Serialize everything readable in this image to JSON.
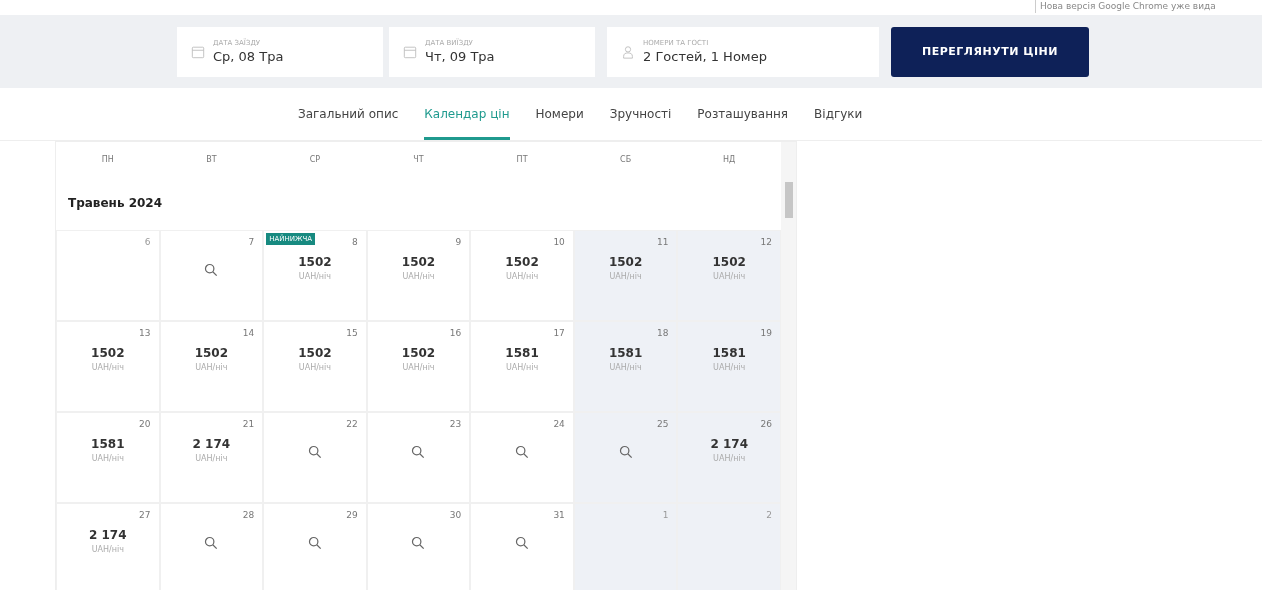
{
  "notice": "Нова версія Google Chrome уже вида",
  "search": {
    "fields": [
      {
        "kind": "date",
        "label": "ДАТА ЗАЇЗДУ",
        "value": "Ср, 08 Тра"
      },
      {
        "kind": "date",
        "label": "ДАТА ВИЇЗДУ",
        "value": "Чт, 09 Тра"
      },
      {
        "kind": "guests",
        "label": "НОМЕРИ ТА ГОСТІ",
        "value": "2 Гостей, 1 Номер"
      }
    ],
    "button": "ПЕРЕГЛЯНУТИ ЦІНИ"
  },
  "tabs": [
    {
      "label": "Загальний опис",
      "selected": false
    },
    {
      "label": "Календар цін",
      "selected": true
    },
    {
      "label": "Номери",
      "selected": false
    },
    {
      "label": "Зручності",
      "selected": false
    },
    {
      "label": "Розташування",
      "selected": false
    },
    {
      "label": "Відгуки",
      "selected": false
    }
  ],
  "calendar": {
    "weekdays": [
      {
        "label": "ПН",
        "weekend": false
      },
      {
        "label": "ВТ",
        "weekend": false
      },
      {
        "label": "СР",
        "weekend": false
      },
      {
        "label": "ЧТ",
        "weekend": false
      },
      {
        "label": "ПТ",
        "weekend": false
      },
      {
        "label": "СБ",
        "weekend": true
      },
      {
        "label": "НД",
        "weekend": true
      }
    ],
    "month": "Травень 2024",
    "weeks": [
      [
        {
          "day": "6",
          "kind": "past"
        },
        {
          "day": "7",
          "kind": "search"
        },
        {
          "day": "8",
          "kind": "price",
          "price": "1502",
          "unit": "UAH/ніч",
          "badge": "НАЙНИЖЧА"
        },
        {
          "day": "9",
          "kind": "price",
          "price": "1502",
          "unit": "UAH/ніч"
        },
        {
          "day": "10",
          "kind": "price",
          "price": "1502",
          "unit": "UAH/ніч"
        },
        {
          "day": "11",
          "kind": "price",
          "price": "1502",
          "unit": "UAH/ніч"
        },
        {
          "day": "12",
          "kind": "price",
          "price": "1502",
          "unit": "UAH/ніч"
        }
      ],
      [
        {
          "day": "13",
          "kind": "price",
          "price": "1502",
          "unit": "UAH/ніч"
        },
        {
          "day": "14",
          "kind": "price",
          "price": "1502",
          "unit": "UAH/ніч"
        },
        {
          "day": "15",
          "kind": "price",
          "price": "1502",
          "unit": "UAH/ніч"
        },
        {
          "day": "16",
          "kind": "price",
          "price": "1502",
          "unit": "UAH/ніч"
        },
        {
          "day": "17",
          "kind": "price",
          "price": "1581",
          "unit": "UAH/ніч"
        },
        {
          "day": "18",
          "kind": "price",
          "price": "1581",
          "unit": "UAH/ніч"
        },
        {
          "day": "19",
          "kind": "price",
          "price": "1581",
          "unit": "UAH/ніч"
        }
      ],
      [
        {
          "day": "20",
          "kind": "price",
          "price": "1581",
          "unit": "UAH/ніч"
        },
        {
          "day": "21",
          "kind": "price",
          "price": "2 174",
          "unit": "UAH/ніч"
        },
        {
          "day": "22",
          "kind": "search"
        },
        {
          "day": "23",
          "kind": "search"
        },
        {
          "day": "24",
          "kind": "search"
        },
        {
          "day": "25",
          "kind": "search"
        },
        {
          "day": "26",
          "kind": "price",
          "price": "2 174",
          "unit": "UAH/ніч"
        }
      ],
      [
        {
          "day": "27",
          "kind": "price",
          "price": "2 174",
          "unit": "UAH/ніч"
        },
        {
          "day": "28",
          "kind": "search"
        },
        {
          "day": "29",
          "kind": "search"
        },
        {
          "day": "30",
          "kind": "search"
        },
        {
          "day": "31",
          "kind": "search"
        },
        {
          "day": "1",
          "kind": "past"
        },
        {
          "day": "2",
          "kind": "past"
        }
      ]
    ]
  }
}
